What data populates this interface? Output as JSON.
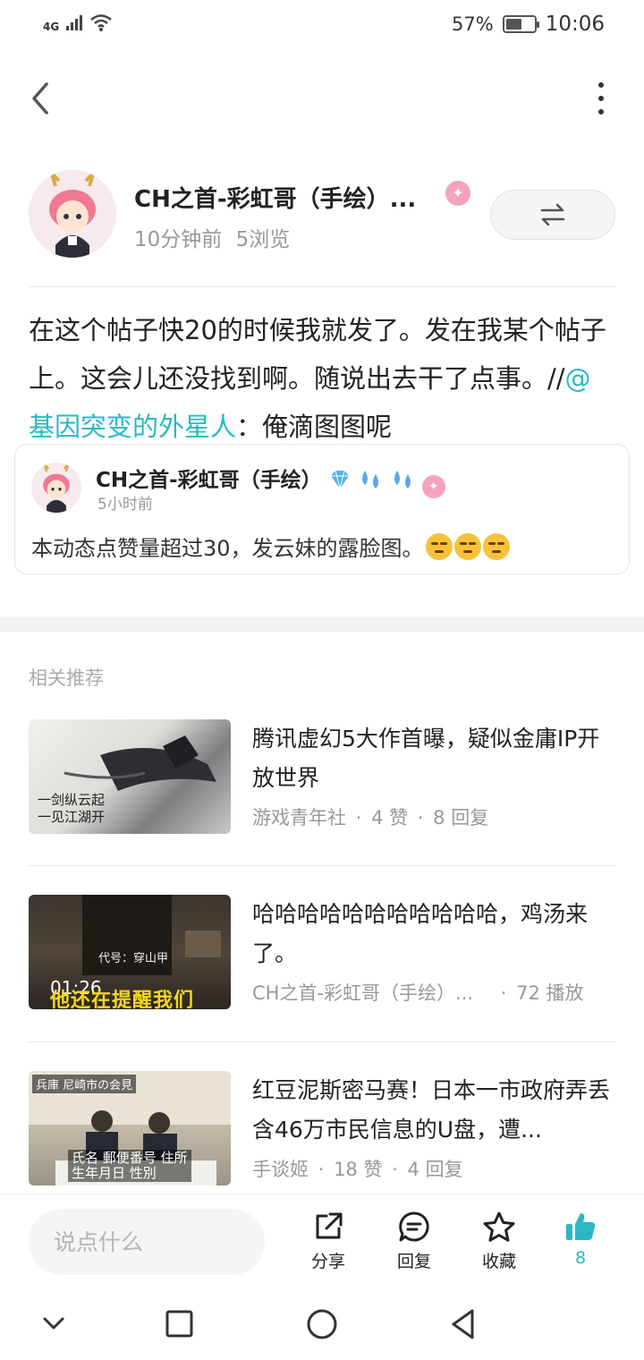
{
  "status_bar": {
    "network": "4G",
    "battery": "57%",
    "battery_level": 0.57,
    "time": "10:06"
  },
  "top_bar": {
    "back_icon": "chevron-left-icon",
    "more_icon": "more-vertical-icon"
  },
  "author": {
    "name": "CH之首-彩虹哥（手绘）...",
    "time_ago": "10分钟前",
    "views": "5浏览",
    "repost_icon": "swap-arrows-icon"
  },
  "post": {
    "text_before": "在这个帖子快20的时候我就发了。发在我某个帖子上。这会儿还没找到啊。随说出去干了点事。//",
    "mention": "@基因突变的外星人",
    "text_after": "：俺滴图图呢"
  },
  "quoted": {
    "name": "CH之首-彩虹哥（手绘）",
    "time": "5小时前",
    "text": "本动态点赞量超过30，发云妹的露脸图。"
  },
  "related": {
    "title": "相关推荐",
    "items": [
      {
        "title": "腾讯虚幻5大作首曝，疑似金庸IP开放世界",
        "source": "游戏青年社",
        "stat1": "4 赞",
        "stat2": "8 回复"
      },
      {
        "title": "哈哈哈哈哈哈哈哈哈哈哈，鸡汤来了。",
        "source": "CH之首-彩虹哥（手绘）...",
        "stat1": "72 播放",
        "duration": "01:26",
        "overlay": "代号：穿山甲",
        "caption": "他还在提醒我们"
      },
      {
        "title": "红豆泥斯密马赛！日本一市政府弄丢含46万市民信息的U盘，遭...",
        "source": "手谈姬",
        "stat1": "18 赞",
        "stat2": "4 回复",
        "tag": "兵庫 尼崎市の会見",
        "sub_line1": "氏名 郵便番号 住所",
        "sub_line2": "生年月日 性別"
      }
    ]
  },
  "bottom_bar": {
    "comment_placeholder": "说点什么",
    "share_label": "分享",
    "reply_label": "回复",
    "favorite_label": "收藏",
    "like_count": "8"
  },
  "colors": {
    "accent": "#2ab9c4",
    "text": "#222222",
    "muted": "#999999"
  }
}
